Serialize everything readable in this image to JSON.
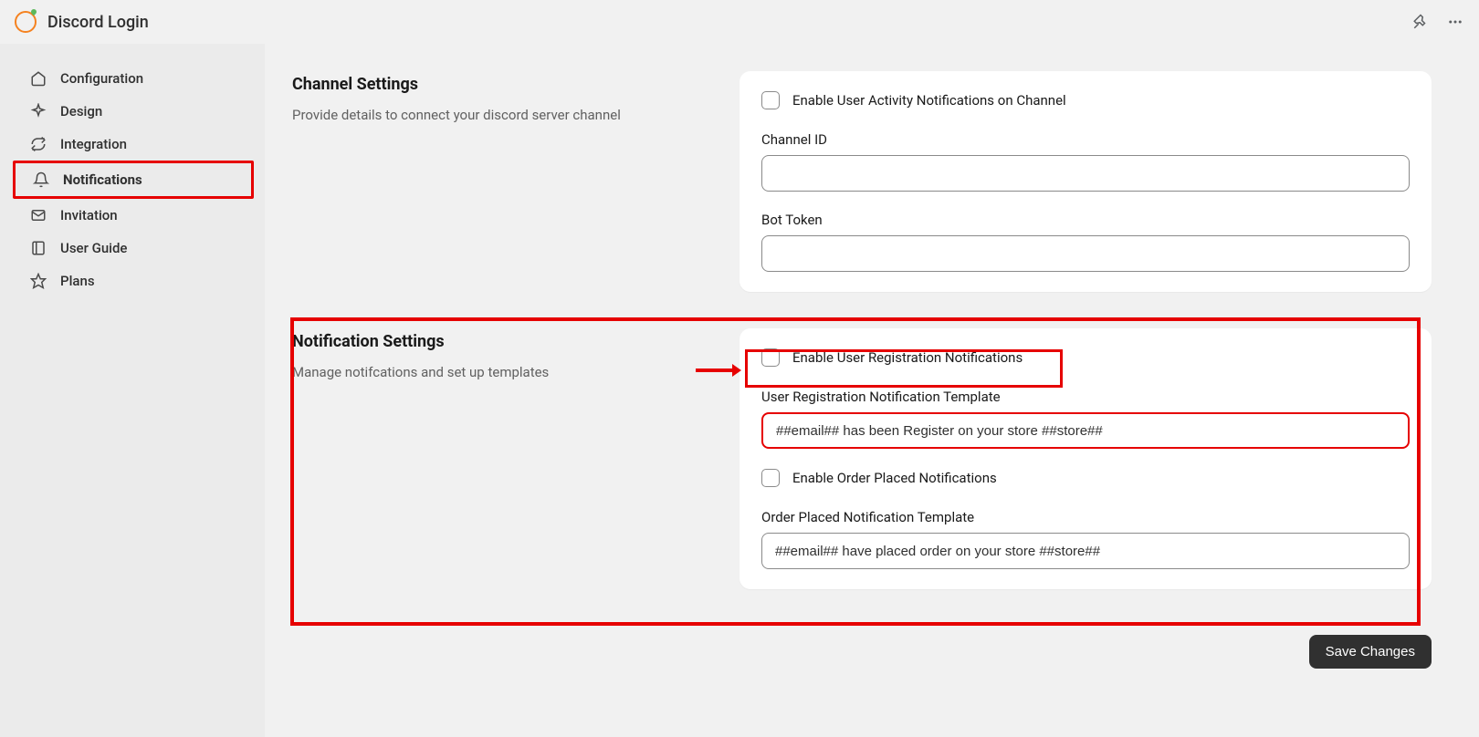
{
  "header": {
    "title": "Discord Login"
  },
  "sidebar": {
    "items": [
      {
        "label": "Configuration",
        "icon": "home-icon"
      },
      {
        "label": "Design",
        "icon": "sparkle-icon"
      },
      {
        "label": "Integration",
        "icon": "sync-icon"
      },
      {
        "label": "Notifications",
        "icon": "bell-icon",
        "active": true
      },
      {
        "label": "Invitation",
        "icon": "envelope-icon"
      },
      {
        "label": "User Guide",
        "icon": "book-icon"
      },
      {
        "label": "Plans",
        "icon": "star-icon"
      }
    ]
  },
  "channel_settings": {
    "title": "Channel Settings",
    "desc": "Provide details to connect your discord server channel",
    "enable_label": "Enable User Activity Notifications on Channel",
    "channel_id_label": "Channel ID",
    "channel_id_value": "",
    "bot_token_label": "Bot Token",
    "bot_token_value": ""
  },
  "notification_settings": {
    "title": "Notification Settings",
    "desc": "Manage notifcations and set up templates",
    "enable_registration_label": "Enable User Registration Notifications",
    "registration_template_label": "User Registration Notification Template",
    "registration_template_value": "##email## has been Register on your store ##store##",
    "enable_order_label": "Enable Order Placed Notifications",
    "order_template_label": "Order Placed Notification Template",
    "order_template_value": "##email## have placed order on your store ##store##"
  },
  "footer": {
    "save_label": "Save Changes"
  }
}
